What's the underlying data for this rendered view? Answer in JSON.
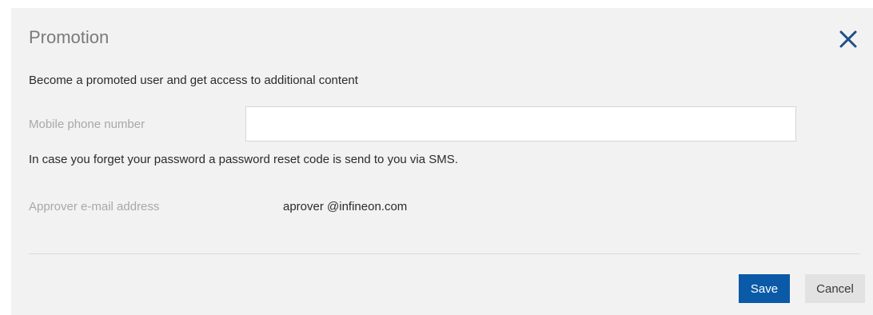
{
  "dialog": {
    "title": "Promotion",
    "close_icon": "close-icon",
    "intro": "Become a promoted user and get access to additional content",
    "phone": {
      "label": "Mobile phone number",
      "value": "",
      "placeholder": ""
    },
    "hint": "In case you forget your password a password reset code is send to you via SMS.",
    "approver": {
      "label": "Approver e-mail address",
      "value": "aprover @infineon.com"
    },
    "buttons": {
      "save_label": "Save",
      "cancel_label": "Cancel"
    }
  },
  "colors": {
    "accent": "#0a5aa8",
    "dialog_background": "#f3f2f2",
    "muted_label": "#a8a8a8",
    "cancel_background": "#e2e2e2"
  }
}
